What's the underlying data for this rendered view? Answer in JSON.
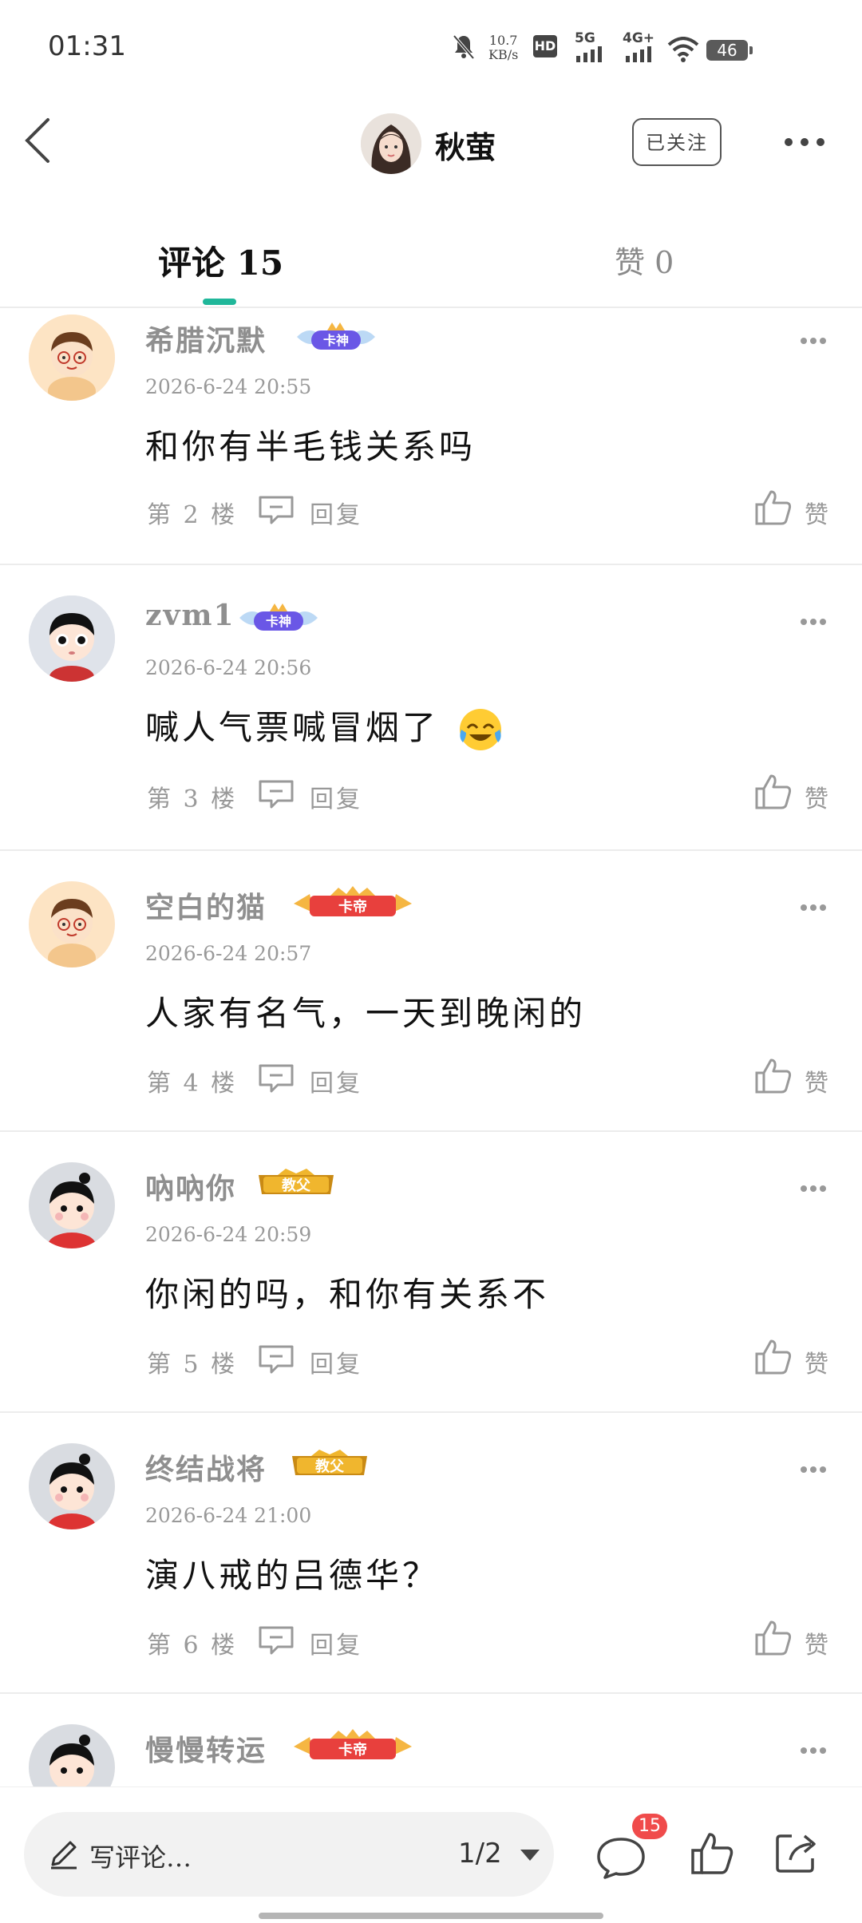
{
  "status_bar": {
    "time": "01:31",
    "speed_value": "10.7",
    "speed_unit": "KB/s",
    "hd": "HD",
    "net_5g": "5G",
    "net_4g": "4G+",
    "battery": "46"
  },
  "header": {
    "title": "秋萤",
    "follow_label": "已关注"
  },
  "tabs": {
    "comments_label": "评论 15",
    "likes_label": "赞 0"
  },
  "comments": [
    {
      "name": "希腊沉默",
      "badge": "卡神",
      "time": "2026-6-24 20:55",
      "text": "和你有半毛钱关系吗",
      "floor": "第 2 楼",
      "reply": "回复",
      "like": "赞"
    },
    {
      "name": "zvm1",
      "badge": "卡神",
      "time": "2026-6-24 20:56",
      "text": "喊人气票喊冒烟了",
      "emoji": "crying-laughing",
      "floor": "第 3 楼",
      "reply": "回复",
      "like": "赞"
    },
    {
      "name": "空白的猫",
      "badge": "卡帝",
      "time": "2026-6-24 20:57",
      "text": "人家有名气，一天到晚闲的",
      "floor": "第 4 楼",
      "reply": "回复",
      "like": "赞"
    },
    {
      "name": "吶吶你",
      "badge": "教父",
      "time": "2026-6-24 20:59",
      "text": "你闲的吗，和你有关系不",
      "floor": "第 5 楼",
      "reply": "回复",
      "like": "赞"
    },
    {
      "name": "终结战将",
      "badge": "教父",
      "time": "2026-6-24 21:00",
      "text": "演八戒的吕德华？",
      "floor": "第 6 楼",
      "reply": "回复",
      "like": "赞"
    },
    {
      "name": "慢慢转运",
      "badge": "卡帝"
    }
  ],
  "bottom": {
    "placeholder": "写评论…",
    "page": "1/2",
    "comment_count": "15"
  },
  "colors": {
    "accent": "#20b79a",
    "badge_red": "#f04b4b",
    "text_gray": "#999999"
  },
  "icons": {
    "back": "back-arrow-icon",
    "more": "more-dots-icon",
    "reply": "comment-bubble-icon",
    "like": "thumbs-up-icon",
    "share": "share-icon",
    "pencil": "pencil-icon"
  }
}
